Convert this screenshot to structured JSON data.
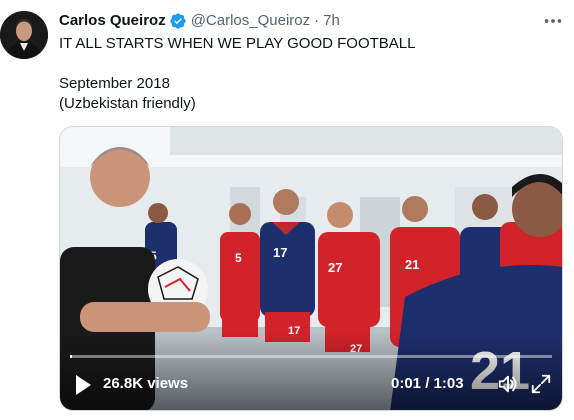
{
  "tweet": {
    "author_name": "Carlos Queiroz",
    "handle": "@Carlos_Queiroz",
    "separator": "·",
    "time": "7h",
    "text_line1": "IT ALL STARTS WHEN WE PLAY GOOD FOOTBALL",
    "text_line2": "September 2018",
    "text_line3": "(Uzbekistan friendly)"
  },
  "video": {
    "views": "26.8K views",
    "timecode": "0:01 / 1:03",
    "progress_fraction": 0.005
  },
  "player_numbers": [
    "5",
    "17",
    "27",
    "21",
    "17",
    "27",
    "21"
  ],
  "colors": {
    "verified_blue": "#1d9bf0",
    "secondary_text": "#536471",
    "iran_red": "#d3232a",
    "navy": "#1e2f6e"
  },
  "icons": {
    "verified": "verified-badge-icon",
    "more": "more-horizontal-icon",
    "play": "play-icon",
    "volume": "volume-icon",
    "fullscreen": "fullscreen-icon"
  }
}
